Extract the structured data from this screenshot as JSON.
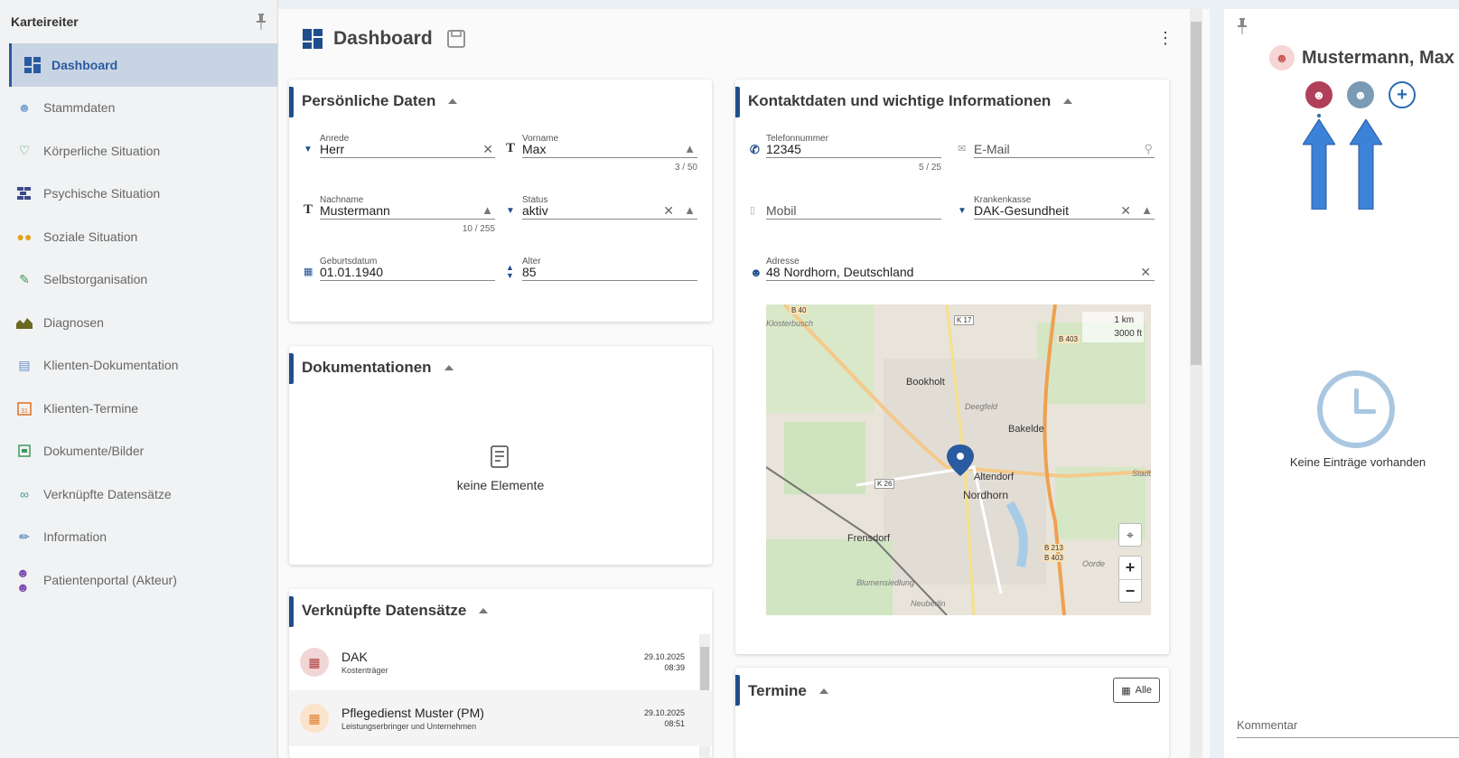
{
  "sidebar": {
    "title": "Karteireiter",
    "items": [
      {
        "label": "Dashboard",
        "icon": "dashboard-icon"
      },
      {
        "label": "Stammdaten",
        "icon": "person-icon"
      },
      {
        "label": "Körperliche Situation",
        "icon": "heart-icon"
      },
      {
        "label": "Psychische Situation",
        "icon": "brick-icon"
      },
      {
        "label": "Soziale Situation",
        "icon": "group-icon"
      },
      {
        "label": "Selbstorganisation",
        "icon": "edit-icon"
      },
      {
        "label": "Diagnosen",
        "icon": "chart-icon"
      },
      {
        "label": "Klienten-Dokumentation",
        "icon": "document-icon"
      },
      {
        "label": "Klienten-Termine",
        "icon": "calendar-icon"
      },
      {
        "label": "Dokumente/Bilder",
        "icon": "image-icon"
      },
      {
        "label": "Verknüpfte Datensätze",
        "icon": "link-icon"
      },
      {
        "label": "Information",
        "icon": "pencil-icon"
      },
      {
        "label": "Patientenportal (Akteur)",
        "icon": "users-icon"
      }
    ]
  },
  "header": {
    "title": "Dashboard"
  },
  "personal": {
    "title": "Persönliche Daten",
    "anrede_label": "Anrede",
    "anrede": "Herr",
    "vorname_label": "Vorname",
    "vorname": "Max",
    "vorname_count": "3 / 50",
    "nachname_label": "Nachname",
    "nachname": "Mustermann",
    "nachname_count": "10 / 255",
    "status_label": "Status",
    "status": "aktiv",
    "geburt_label": "Geburtsdatum",
    "geburt": "01.01.1940",
    "alter_label": "Alter",
    "alter": "85"
  },
  "contact": {
    "title": "Kontaktdaten und wichtige Informationen",
    "tel_label": "Telefonnummer",
    "tel": "12345",
    "tel_count": "5 / 25",
    "email_placeholder": "E-Mail",
    "mobil_placeholder": "Mobil",
    "kasse_label": "Krankenkasse",
    "kasse": "DAK-Gesundheit",
    "adresse_label": "Adresse",
    "adresse": "48 Nordhorn, Deutschland"
  },
  "map": {
    "scale_km": "1 km",
    "scale_ft": "3000 ft",
    "places": [
      "Bookholt",
      "Bakelde",
      "Altendorf",
      "Nordhorn",
      "Frensdorf",
      "Blumensiedlung",
      "Neuberlin",
      "Klosterbusch",
      "Deegfeld",
      "Oorde",
      "Stadtf"
    ],
    "roads": [
      "B 403",
      "K 17",
      "K 26",
      "B 213",
      "B 403",
      "B 40"
    ],
    "zoom_in": "+",
    "zoom_out": "−"
  },
  "docs": {
    "title": "Dokumentationen",
    "empty": "keine Elemente"
  },
  "linked": {
    "title": "Verknüpfte Datensätze",
    "rows": [
      {
        "name": "DAK",
        "sub": "Kostenträger",
        "date": "29.10.2025",
        "time": "08:39"
      },
      {
        "name": "Pflegedienst Muster (PM)",
        "sub": "Leistungserbringer und Unternehmen",
        "date": "29.10.2025",
        "time": "08:51"
      }
    ]
  },
  "termine": {
    "title": "Termine",
    "all_label": "Alle"
  },
  "right": {
    "name": "Mustermann, Max",
    "empty": "Keine Einträge vorhanden",
    "comment_placeholder": "Kommentar"
  },
  "colors": {
    "accent": "#1f4e8c",
    "active_bg": "#c8d4e3",
    "arrow": "#3b82d8"
  }
}
